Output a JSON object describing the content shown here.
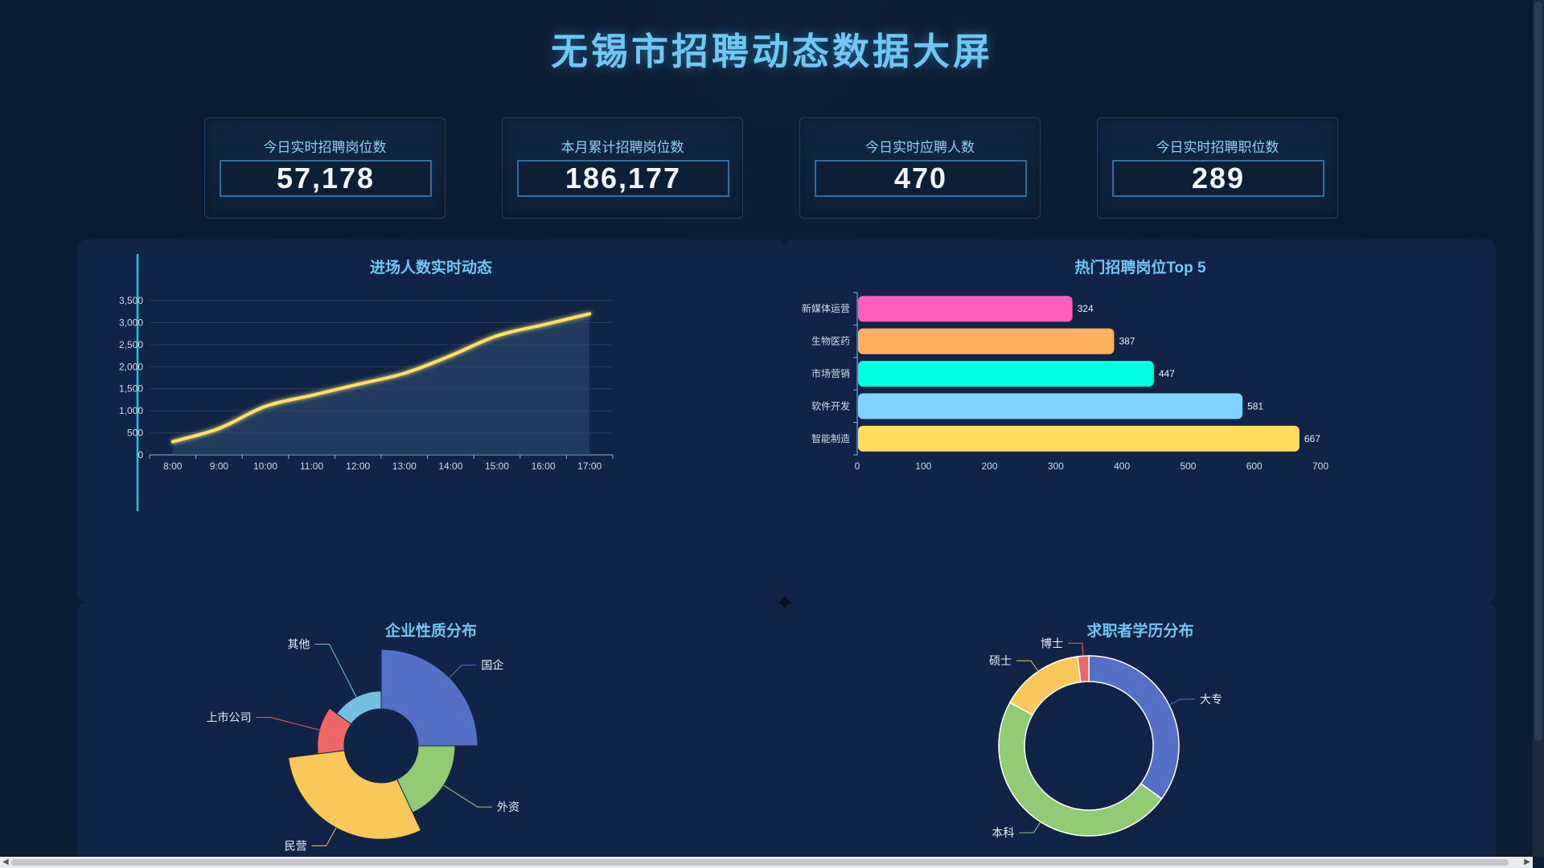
{
  "header": {
    "title": "无锡市招聘动态数据大屏"
  },
  "stats": [
    {
      "label": "今日实时招聘岗位数",
      "value": "57,178"
    },
    {
      "label": "本月累计招聘岗位数",
      "value": "186,177"
    },
    {
      "label": "今日实时应聘人数",
      "value": "470"
    },
    {
      "label": "今日实时招聘职位数",
      "value": "289"
    }
  ],
  "panels": {
    "entry": {
      "title": "进场人数实时动态"
    },
    "top5": {
      "title": "热门招聘岗位Top 5"
    },
    "company": {
      "title": "企业性质分布"
    },
    "education": {
      "title": "求职者学历分布"
    }
  },
  "chart_data": [
    {
      "type": "area",
      "title": "进场人数实时动态",
      "categories": [
        "8:00",
        "9:00",
        "10:00",
        "11:00",
        "12:00",
        "13:00",
        "14:00",
        "15:00",
        "16:00",
        "17:00"
      ],
      "values": [
        300,
        600,
        1100,
        1350,
        1600,
        1850,
        2250,
        2700,
        2950,
        3200
      ],
      "ylim": [
        0,
        3500
      ],
      "yticks": [
        "0",
        "500",
        "1,000",
        "1,500",
        "2,000",
        "2,500",
        "3,000",
        "3,500"
      ],
      "grid": true,
      "line_color": "#ffe066"
    },
    {
      "type": "bar",
      "orientation": "horizontal",
      "title": "热门招聘岗位Top 5",
      "categories": [
        "新媒体运营",
        "生物医药",
        "市场营销",
        "软件开发",
        "智能制造"
      ],
      "values": [
        324,
        387,
        447,
        581,
        667
      ],
      "colors": [
        "#ff5ebc",
        "#ffb05c",
        "#00ffe0",
        "#7fd4ff",
        "#ffdd5c"
      ],
      "xlim": [
        0,
        700
      ],
      "xticks": [
        "0",
        "100",
        "200",
        "300",
        "400",
        "500",
        "600",
        "700"
      ]
    },
    {
      "type": "pie",
      "variant": "rose",
      "title": "企业性质分布",
      "labels": [
        "国企",
        "外资",
        "民营",
        "上市公司",
        "其他"
      ],
      "values": [
        25,
        18,
        30,
        12,
        15
      ],
      "radii": [
        1.0,
        0.62,
        0.95,
        0.45,
        0.3
      ],
      "colors": [
        "#5470c6",
        "#91cc75",
        "#fac858",
        "#ee6666",
        "#73c0de"
      ]
    },
    {
      "type": "pie",
      "variant": "donut",
      "title": "求职者学历分布",
      "labels": [
        "大专",
        "本科",
        "硕士",
        "博士"
      ],
      "values": [
        35,
        48,
        15,
        2
      ],
      "colors": [
        "#5470c6",
        "#91cc75",
        "#fac858",
        "#ee6666"
      ]
    }
  ]
}
